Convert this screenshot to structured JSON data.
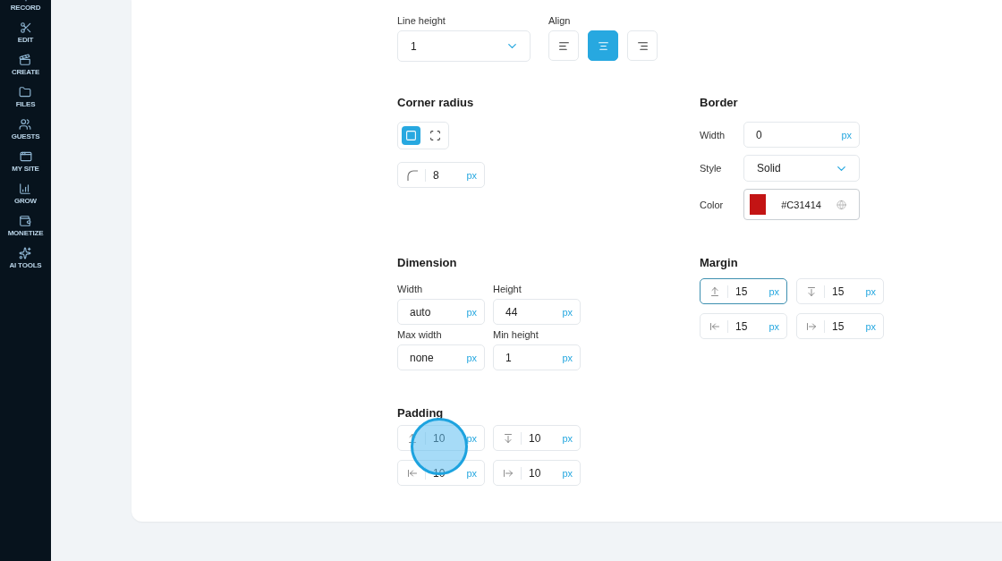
{
  "sidebar": {
    "items": [
      {
        "kind": "record",
        "label": "RECORD"
      },
      {
        "kind": "edit",
        "label": "EDIT"
      },
      {
        "kind": "create",
        "label": "CREATE"
      },
      {
        "kind": "files",
        "label": "FILES"
      },
      {
        "kind": "guests",
        "label": "GUESTS"
      },
      {
        "kind": "site",
        "label": "MY SITE"
      },
      {
        "kind": "grow",
        "label": "GROW"
      },
      {
        "kind": "monetize",
        "label": "MONETIZE"
      },
      {
        "kind": "ai",
        "label": "AI TOOLS"
      }
    ]
  },
  "line_height": {
    "label": "Line height",
    "value": "1"
  },
  "align": {
    "label": "Align",
    "options": [
      {
        "kind": "left",
        "selected": false
      },
      {
        "kind": "center",
        "selected": true
      },
      {
        "kind": "right",
        "selected": false
      }
    ]
  },
  "corner_radius": {
    "title": "Corner radius",
    "modes": [
      {
        "kind": "uniform",
        "selected": true
      },
      {
        "kind": "individual",
        "selected": false
      }
    ],
    "radius": {
      "value": "8",
      "unit": "px"
    }
  },
  "border": {
    "title": "Border",
    "width": {
      "label": "Width",
      "value": "0",
      "unit": "px"
    },
    "style": {
      "label": "Style",
      "value": "Solid"
    },
    "color": {
      "label": "Color",
      "value": "#C31414",
      "color": "#c31414"
    }
  },
  "dimension": {
    "title": "Dimension",
    "fields": [
      {
        "label": "Width",
        "value": "auto",
        "unit": "px"
      },
      {
        "label": "Height",
        "value": "44",
        "unit": "px"
      },
      {
        "label": "Max width",
        "value": "none",
        "unit": "px"
      },
      {
        "label": "Min height",
        "value": "1",
        "unit": "px"
      }
    ]
  },
  "margin": {
    "title": "Margin",
    "fields": [
      {
        "kind": "top",
        "value": "15",
        "unit": "px",
        "focused": true
      },
      {
        "kind": "bottom",
        "value": "15",
        "unit": "px",
        "focused": false
      },
      {
        "kind": "left",
        "value": "15",
        "unit": "px",
        "focused": false
      },
      {
        "kind": "right",
        "value": "15",
        "unit": "px",
        "focused": false
      }
    ]
  },
  "padding": {
    "title": "Padding",
    "fields": [
      {
        "kind": "top",
        "value": "10",
        "unit": "px",
        "focused": false
      },
      {
        "kind": "bottom",
        "value": "10",
        "unit": "px",
        "focused": false
      },
      {
        "kind": "left",
        "value": "10",
        "unit": "px",
        "focused": false
      },
      {
        "kind": "right",
        "value": "10",
        "unit": "px",
        "focused": false
      }
    ]
  }
}
